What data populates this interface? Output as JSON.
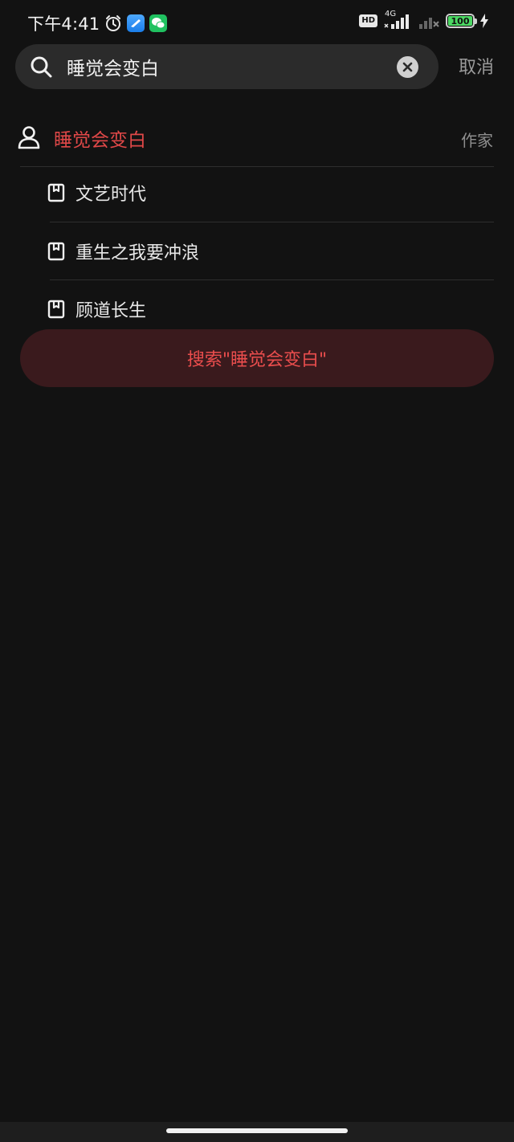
{
  "status_bar": {
    "time": "下午4:41",
    "network": "4G",
    "hd": "HD",
    "battery": "100"
  },
  "search": {
    "query": "睡觉会变白",
    "cancel_label": "取消"
  },
  "author_result": {
    "name": "睡觉会变白",
    "tag": "作家"
  },
  "books": [
    {
      "title": "文艺时代"
    },
    {
      "title": "重生之我要冲浪"
    },
    {
      "title": "顾道长生"
    }
  ],
  "search_action": {
    "label": "搜索\"睡觉会变白\""
  },
  "colors": {
    "accent": "#e04848",
    "background": "#121212",
    "search_bg": "#2b2b2b",
    "action_bg": "#3a1a1d"
  }
}
